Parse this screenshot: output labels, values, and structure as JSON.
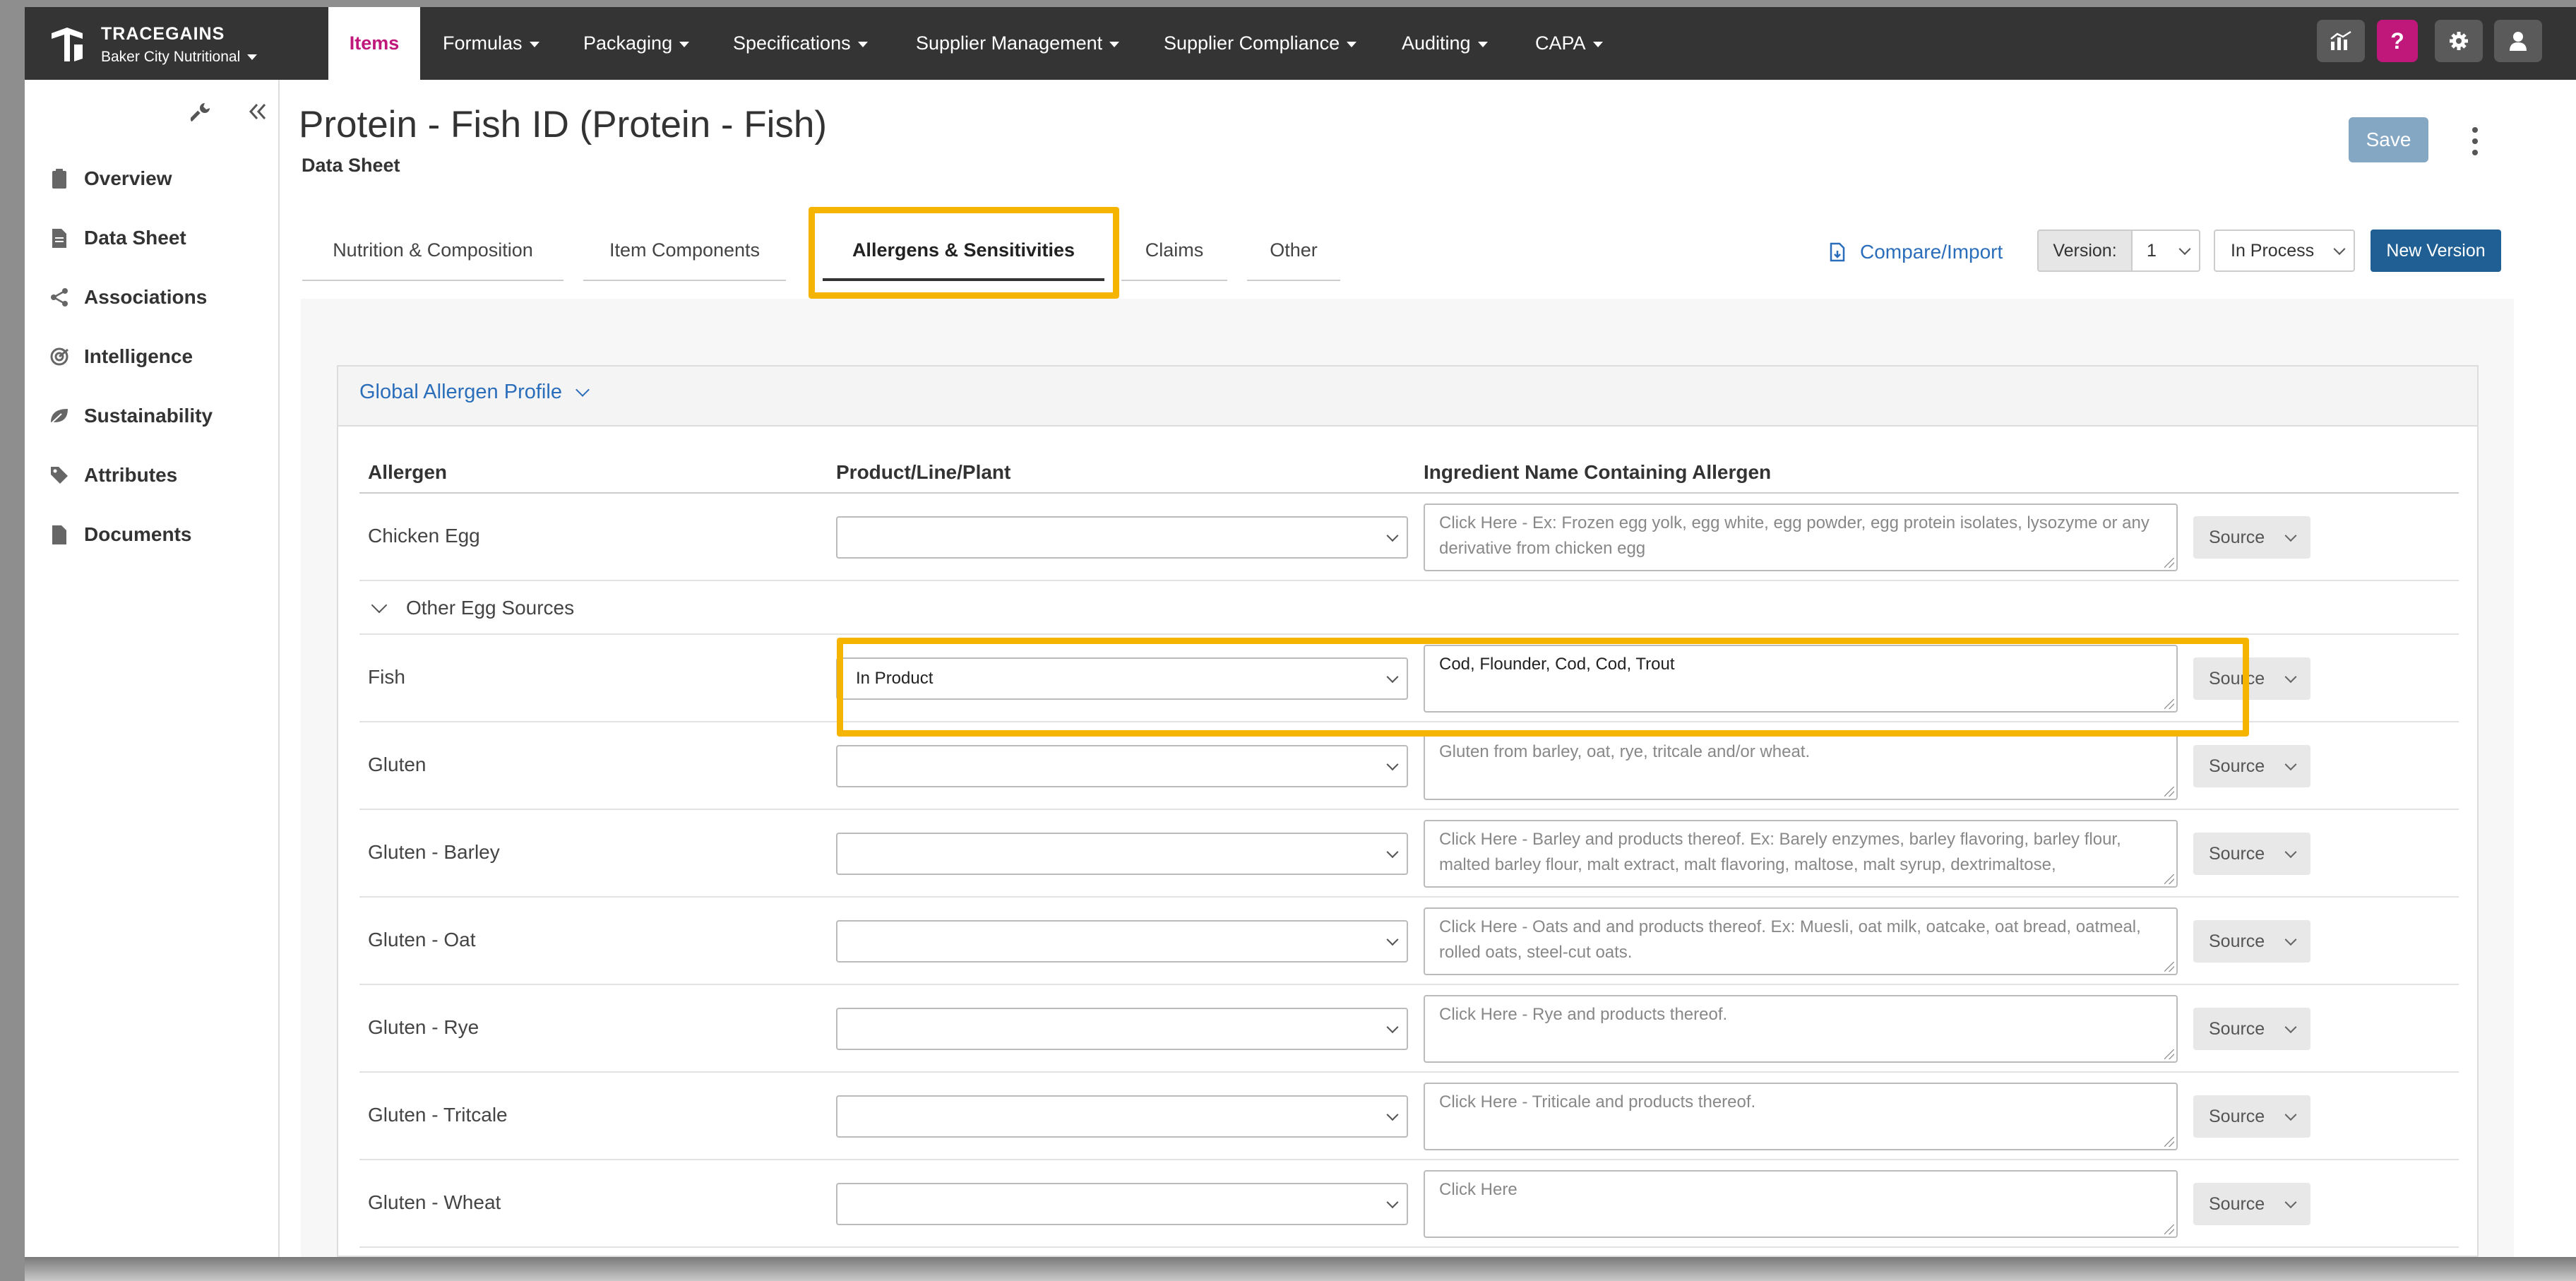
{
  "brand": {
    "name": "TRACEGAINS",
    "org": "Baker City Nutritional"
  },
  "nav": [
    {
      "label": "Items",
      "active": true
    },
    {
      "label": "Formulas"
    },
    {
      "label": "Packaging"
    },
    {
      "label": "Specifications"
    },
    {
      "label": "Supplier Management"
    },
    {
      "label": "Supplier Compliance"
    },
    {
      "label": "Auditing"
    },
    {
      "label": "CAPA"
    }
  ],
  "toolbar_icons": [
    "analytics-icon",
    "help-icon",
    "gear-icon",
    "user-icon"
  ],
  "help_glyph": "?",
  "sidebar": {
    "items": [
      {
        "label": "Overview",
        "icon": "clipboard-icon"
      },
      {
        "label": "Data Sheet",
        "icon": "document-icon"
      },
      {
        "label": "Associations",
        "icon": "share-icon"
      },
      {
        "label": "Intelligence",
        "icon": "radar-icon"
      },
      {
        "label": "Sustainability",
        "icon": "leaf-icon"
      },
      {
        "label": "Attributes",
        "icon": "tag-icon"
      },
      {
        "label": "Documents",
        "icon": "file-icon"
      }
    ]
  },
  "header": {
    "title": "Protein - Fish ID (Protein - Fish)",
    "subtitle": "Data Sheet",
    "save_label": "Save"
  },
  "tabs": [
    {
      "label": "Nutrition & Composition"
    },
    {
      "label": "Item Components"
    },
    {
      "label": "Allergens & Sensitivities",
      "active": true
    },
    {
      "label": "Claims"
    },
    {
      "label": "Other"
    }
  ],
  "actions": {
    "compare_label": "Compare/Import",
    "version_label": "Version:",
    "version_value": "1",
    "status_value": "In Process",
    "new_version_label": "New Version"
  },
  "profile": {
    "title": "Global Allergen Profile",
    "columns": {
      "allergen": "Allergen",
      "plant": "Product/Line/Plant",
      "ingredient": "Ingredient Name Containing Allergen"
    },
    "source_label": "Source",
    "rows": [
      {
        "allergen": "Chicken Egg",
        "plant": "",
        "placeholder": "Click Here - Ex: Frozen egg yolk, egg white, egg powder, egg protein isolates, lysozyme or any derivative from chicken egg",
        "value": ""
      },
      {
        "allergen": "Other Egg Sources",
        "subgroup": true
      },
      {
        "allergen": "Fish",
        "plant": "In Product",
        "placeholder": "",
        "value": "Cod, Flounder, Cod, Cod, Trout"
      },
      {
        "allergen": "Gluten",
        "plant": "",
        "placeholder": "Gluten from barley, oat, rye, tritcale and/or wheat.",
        "value": ""
      },
      {
        "allergen": "Gluten - Barley",
        "plant": "",
        "placeholder": "Click Here - Barley and products thereof. Ex: Barely enzymes, barley flavoring, barley flour, malted barley flour, malt extract, malt flavoring, maltose, malt syrup, dextrimaltose,",
        "value": ""
      },
      {
        "allergen": "Gluten - Oat",
        "plant": "",
        "placeholder": "Click Here - Oats and and products thereof. Ex: Muesli, oat milk, oatcake, oat bread, oatmeal, rolled oats, steel-cut oats.",
        "value": ""
      },
      {
        "allergen": "Gluten - Rye",
        "plant": "",
        "placeholder": "Click Here - Rye and products thereof.",
        "value": ""
      },
      {
        "allergen": "Gluten - Tritcale",
        "plant": "",
        "placeholder": "Click Here - Triticale and products thereof.",
        "value": ""
      },
      {
        "allergen": "Gluten - Wheat",
        "plant": "",
        "placeholder": "Click Here",
        "value": ""
      }
    ]
  },
  "colors": {
    "nav_bg": "#343434",
    "active_nav": "#c0177a",
    "highlight": "#f4b400",
    "link": "#2a6ebb",
    "primary": "#1f5f94",
    "save_disabled": "#84a7c4"
  }
}
